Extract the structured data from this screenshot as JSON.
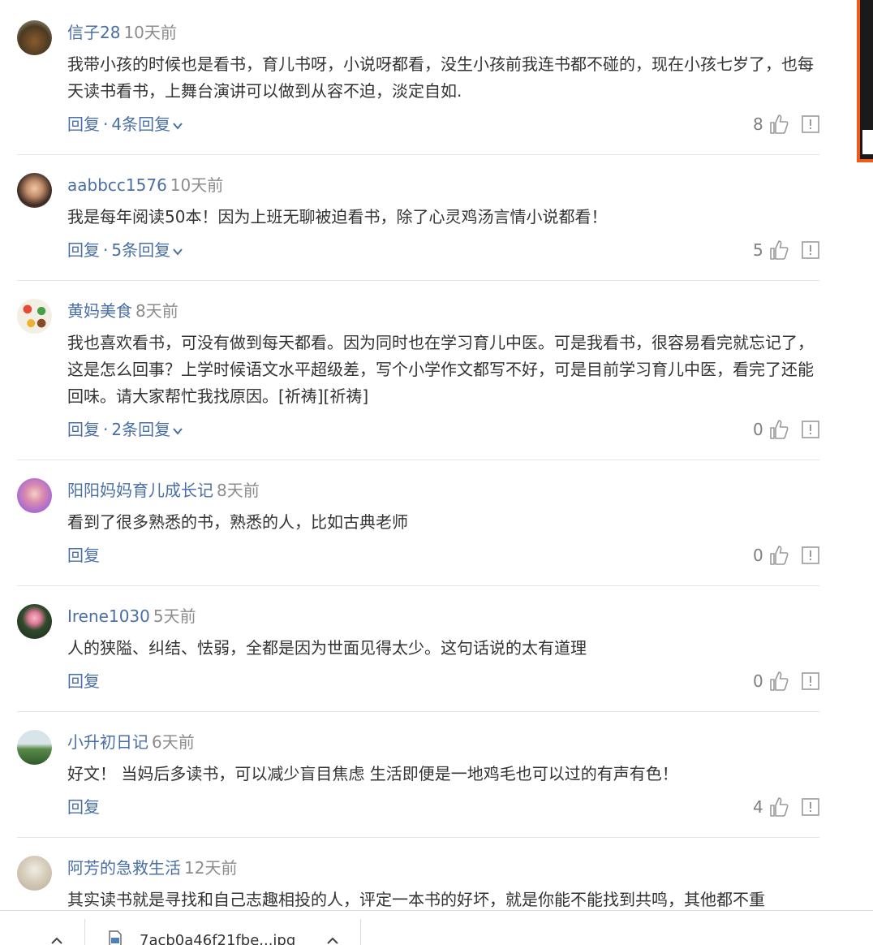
{
  "comments": [
    {
      "username": "信子28",
      "time": "10天前",
      "content": "我带小孩的时候也是看书，育儿书呀，小说呀都看，没生小孩前我连书都不碰的，现在小孩七岁了，也每天读书看书，上舞台演讲可以做到从容不迫，淡定自如.",
      "reply_label": "回复",
      "reply_count_label": "4条回复",
      "likes": "8"
    },
    {
      "username": "aabbcc1576",
      "time": "10天前",
      "content": "我是每年阅读50本！因为上班无聊被迫看书，除了心灵鸡汤言情小说都看！",
      "reply_label": "回复",
      "reply_count_label": "5条回复",
      "likes": "5"
    },
    {
      "username": "黄妈美食",
      "time": "8天前",
      "content": "我也喜欢看书，可没有做到每天都看。因为同时也在学习育儿中医。可是我看书，很容易看完就忘记了，这是怎么回事？上学时候语文水平超级差，写个小学作文都写不好，可是目前学习育儿中医，看完了还能回味。请大家帮忙我找原因。[祈祷][祈祷]",
      "reply_label": "回复",
      "reply_count_label": "2条回复",
      "likes": "0"
    },
    {
      "username": "阳阳妈妈育儿成长记",
      "time": "8天前",
      "content": "看到了很多熟悉的书，熟悉的人，比如古典老师",
      "reply_label": "回复",
      "reply_count_label": "",
      "likes": "0"
    },
    {
      "username": "Irene1030",
      "time": "5天前",
      "content": "人的狭隘、纠结、怯弱，全都是因为世面见得太少。这句话说的太有道理",
      "reply_label": "回复",
      "reply_count_label": "",
      "likes": "0"
    },
    {
      "username": "小升初日记",
      "time": "6天前",
      "content": "好文！ 当妈后多读书，可以减少盲目焦虑 生活即便是一地鸡毛也可以过的有声有色！",
      "reply_label": "回复",
      "reply_count_label": "",
      "likes": "4"
    },
    {
      "username": "阿芳的急救生活",
      "time": "12天前",
      "content": "其实读书就是寻找和自己志趣相投的人，评定一本书的好坏，就是你能不能找到共鸣，其他都不重",
      "reply_label": "",
      "reply_count_label": "",
      "likes": ""
    }
  ],
  "download_bar": {
    "filename": "7acb0a46f21fbe...jpg"
  },
  "colors": {
    "link": "#4a6fa5",
    "text": "#333333",
    "muted": "#8c8c8c",
    "accent": "#f25a1c"
  },
  "icons": [
    "thumbs-up-icon",
    "report-icon",
    "chevron-down-icon",
    "file-icon",
    "caret-up-icon"
  ]
}
